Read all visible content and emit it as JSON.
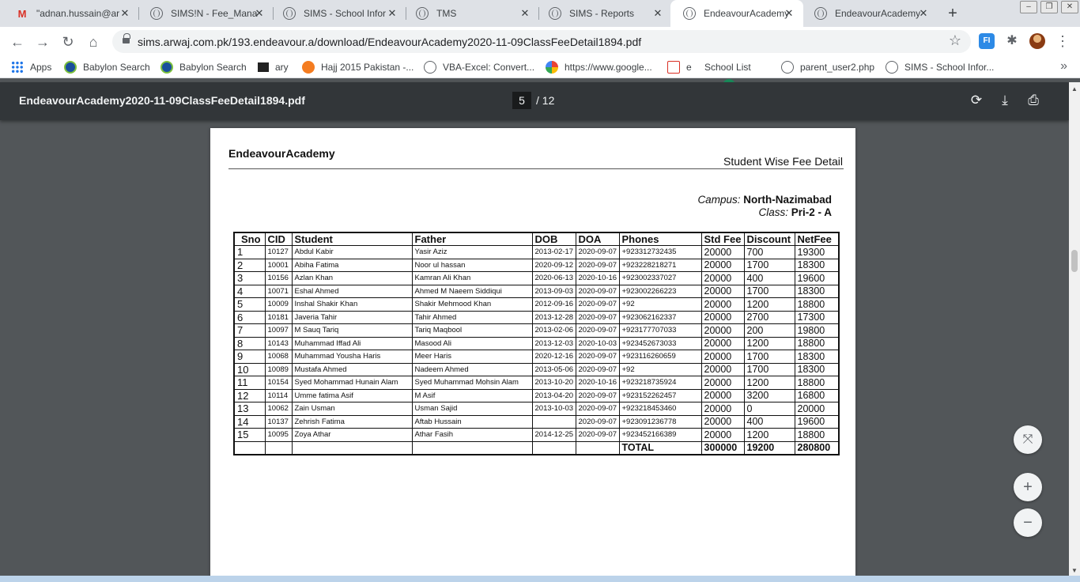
{
  "tabs": [
    {
      "title": "\"adnan.hussain@ar",
      "icon": "gmail-icon",
      "active": false
    },
    {
      "title": "SIMS!N - Fee_Mana",
      "icon": "globe-icon",
      "active": false
    },
    {
      "title": "SIMS - School Infor",
      "icon": "globe-icon",
      "active": false
    },
    {
      "title": "TMS",
      "icon": "globe-icon",
      "active": false
    },
    {
      "title": "SIMS - Reports",
      "icon": "globe-icon",
      "active": false
    },
    {
      "title": "EndeavourAcademy",
      "icon": "globe-icon",
      "active": true
    },
    {
      "title": "EndeavourAcademy",
      "icon": "globe-icon",
      "active": false
    }
  ],
  "toolbar": {
    "url": "sims.arwaj.com.pk/193.endeavour.a/download/EndeavourAcademy2020-11-09ClassFeeDetail1894.pdf",
    "extension_label": "FI"
  },
  "bookmarks": [
    {
      "label": "Apps",
      "icon": "apps-grid-icon"
    },
    {
      "label": "Babylon Search",
      "icon": "babylon-icon"
    },
    {
      "label": "Babylon Search",
      "icon": "babylon-icon"
    },
    {
      "label": "ary",
      "icon": "tv-icon"
    },
    {
      "label": "Hajj 2015 Pakistan -...",
      "icon": "hajj-icon"
    },
    {
      "label": "VBA-Excel: Convert...",
      "icon": "globe-icon"
    },
    {
      "label": "https://www.google...",
      "icon": "google-icon"
    },
    {
      "label": "e",
      "icon": "m100-icon"
    },
    {
      "label": "School List",
      "icon": "school-icon"
    },
    {
      "label": "parent_user2.php",
      "icon": "globe-icon"
    },
    {
      "label": "SIMS - School Infor...",
      "icon": "globe-icon"
    }
  ],
  "pdf": {
    "filename": "EndeavourAcademy2020-11-09ClassFeeDetail1894.pdf",
    "current_page": "5",
    "total_pages": "/ 12"
  },
  "report": {
    "school_name": "EndeavourAcademy",
    "title": "Student Wise Fee Detail",
    "campus_label": "Campus:",
    "campus_value": "North-Nazimabad",
    "class_label": "Class:",
    "class_value": "Pri-2 - A",
    "columns": [
      "Sno",
      "CID",
      "Student",
      "Father",
      "DOB",
      "DOA",
      "Phones",
      "Std Fee",
      "Discount",
      "NetFee"
    ],
    "rows": [
      [
        "1",
        "10127",
        "Abdul Kabir",
        "Yasir Aziz",
        "2013-02-17",
        "2020-09-07",
        "+923312732435",
        "20000",
        "700",
        "19300"
      ],
      [
        "2",
        "10001",
        "Abiha Fatima",
        "Noor ul hassan",
        "2020-09-12",
        "2020-09-07",
        "+923228218271",
        "20000",
        "1700",
        "18300"
      ],
      [
        "3",
        "10156",
        "Azlan Khan",
        "Kamran Ali Khan",
        "2020-06-13",
        "2020-10-16",
        "+923002337027",
        "20000",
        "400",
        "19600"
      ],
      [
        "4",
        "10071",
        "Eshal Ahmed",
        "Ahmed M Naeem Siddiqui",
        "2013-09-03",
        "2020-09-07",
        "+923002266223",
        "20000",
        "1700",
        "18300"
      ],
      [
        "5",
        "10009",
        "Inshal Shakir Khan",
        "Shakir Mehmood Khan",
        "2012-09-16",
        "2020-09-07",
        "+92",
        "20000",
        "1200",
        "18800"
      ],
      [
        "6",
        "10181",
        "Javeria Tahir",
        "Tahir Ahmed",
        "2013-12-28",
        "2020-09-07",
        "+923062162337",
        "20000",
        "2700",
        "17300"
      ],
      [
        "7",
        "10097",
        "M Sauq Tariq",
        "Tariq Maqbool",
        "2013-02-06",
        "2020-09-07",
        "+923177707033",
        "20000",
        "200",
        "19800"
      ],
      [
        "8",
        "10143",
        "Muhammad Iffad Ali",
        "Masood Ali",
        "2013-12-03",
        "2020-10-03",
        "+923452673033",
        "20000",
        "1200",
        "18800"
      ],
      [
        "9",
        "10068",
        "Muhammad Yousha Haris",
        "Meer Haris",
        "2020-12-16",
        "2020-09-07",
        "+923116260659",
        "20000",
        "1700",
        "18300"
      ],
      [
        "10",
        "10089",
        "Mustafa Ahmed",
        "Nadeem Ahmed",
        "2013-05-06",
        "2020-09-07",
        "+92",
        "20000",
        "1700",
        "18300"
      ],
      [
        "11",
        "10154",
        "Syed Mohammad Hunain Alam",
        "Syed Muhammad Mohsin Alam",
        "2013-10-20",
        "2020-10-16",
        "+923218735924",
        "20000",
        "1200",
        "18800"
      ],
      [
        "12",
        "10114",
        "Umme fatima Asif",
        "M Asif",
        "2013-04-20",
        "2020-09-07",
        "+923152262457",
        "20000",
        "3200",
        "16800"
      ],
      [
        "13",
        "10062",
        "Zain Usman",
        "Usman Sajid",
        "2013-10-03",
        "2020-09-07",
        "+923218453460",
        "20000",
        "0",
        "20000"
      ],
      [
        "14",
        "10137",
        "Zehrish Fatima",
        "Aftab Hussain",
        "",
        "2020-09-07",
        "+923091236778",
        "20000",
        "400",
        "19600"
      ],
      [
        "15",
        "10095",
        "Zoya Athar",
        "Athar Fasih",
        "2014-12-25",
        "2020-09-07",
        "+923452166389",
        "20000",
        "1200",
        "18800"
      ]
    ],
    "total": {
      "label": "TOTAL",
      "std_fee": "300000",
      "discount": "19200",
      "net_fee": "280800"
    }
  }
}
